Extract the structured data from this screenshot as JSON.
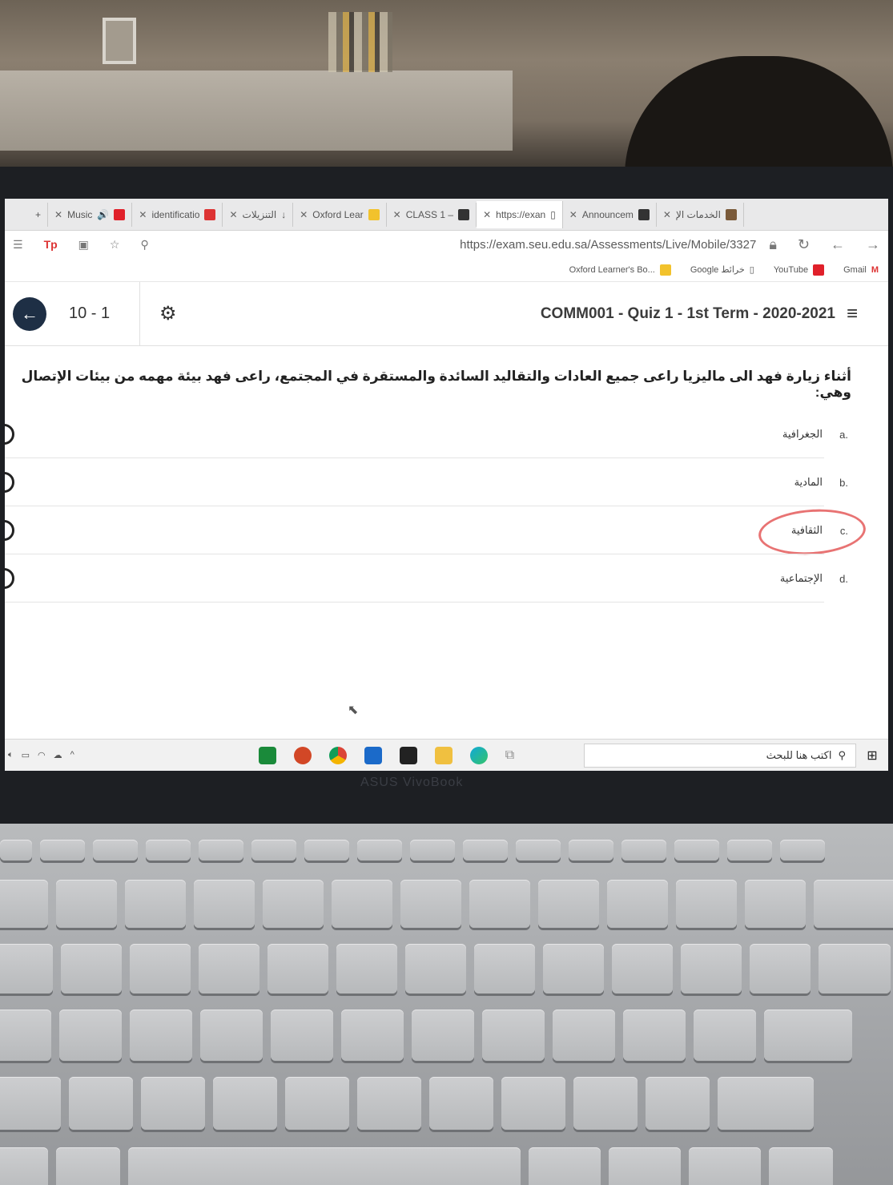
{
  "browser": {
    "tabs": [
      {
        "label": "Music",
        "active": false
      },
      {
        "label": "identificatio",
        "active": false
      },
      {
        "label": "التنزيلات",
        "active": false
      },
      {
        "label": "Oxford Lear",
        "active": false
      },
      {
        "label": "CLASS 1 –",
        "active": false
      },
      {
        "label": "https://exan",
        "active": true
      },
      {
        "label": "Announcem",
        "active": false
      },
      {
        "label": "الخدمات الإ",
        "active": false
      }
    ],
    "url": "https://exam.seu.edu.sa/Assessments/Live/Mobile/3327",
    "favorites": [
      {
        "label": "Oxford Learner's Bo..."
      },
      {
        "label": "Google خرائط"
      },
      {
        "label": "YouTube"
      },
      {
        "label": "Gmail"
      }
    ]
  },
  "quiz": {
    "counter": "10 - 1",
    "title": "COMM001 - Quiz 1 - 1st Term - 2020-2021",
    "question": "أثناء زيارة فهد الى ماليزيا راعى جميع العادات والتقاليد السائدة والمستقرة في المجتمع، راعى فهد بيئة مهمه من بيئات الإتصال وهي:",
    "options": [
      {
        "letter": "a.",
        "text": "الجغرافية"
      },
      {
        "letter": "b.",
        "text": "المادية"
      },
      {
        "letter": "c.",
        "text": "الثقافية"
      },
      {
        "letter": "d.",
        "text": "الإجتماعية"
      }
    ]
  },
  "taskbar": {
    "search_placeholder": "اكتب هنا للبحث"
  },
  "laptop": {
    "brand": "ASUS VivoBook"
  },
  "colors": {
    "back_button": "#1e2f45",
    "annotation_circle": "#e87373"
  }
}
